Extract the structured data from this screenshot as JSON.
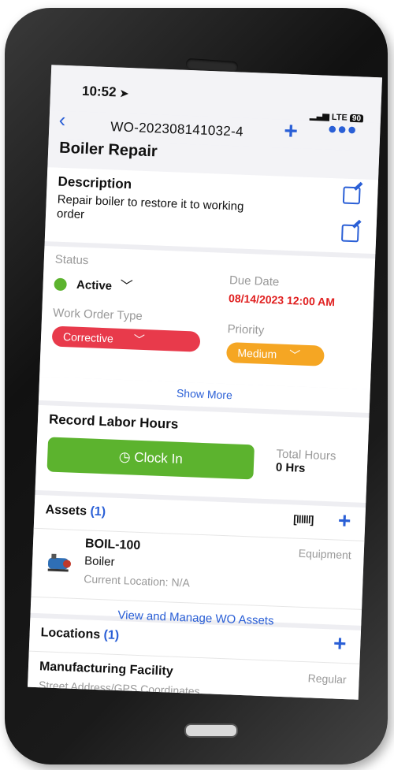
{
  "status_bar": {
    "time": "10:52",
    "network": "LTE",
    "battery": "90"
  },
  "nav": {
    "work_order_id": "WO-202308141032-4"
  },
  "page": {
    "title": "Boiler Repair"
  },
  "description": {
    "label": "Description",
    "text": "Repair boiler to restore it to working order"
  },
  "details": {
    "status_label": "Status",
    "status_value": "Active",
    "due_label": "Due Date",
    "due_value": "08/14/2023 12:00 AM",
    "type_label": "Work Order Type",
    "type_value": "Corrective",
    "priority_label": "Priority",
    "priority_value": "Medium",
    "show_more": "Show More"
  },
  "labor": {
    "title": "Record Labor Hours",
    "clock_in": "Clock In",
    "total_label": "Total Hours",
    "total_value": "0 Hrs"
  },
  "assets": {
    "title": "Assets",
    "count": "(1)",
    "item": {
      "code": "BOIL-100",
      "name": "Boiler",
      "location": "Current Location: N/A",
      "category": "Equipment"
    },
    "manage_link": "View and Manage WO Assets"
  },
  "locations": {
    "title": "Locations",
    "count": "(1)",
    "item": {
      "name": "Manufacturing Facility",
      "type": "Regular",
      "address": "Street Address/GPS Coordinates"
    }
  },
  "colors": {
    "accent": "#2a5fd6",
    "active_green": "#5cb32e",
    "corrective_red": "#e83a4b",
    "medium_orange": "#f5a623",
    "due_red": "#e02020"
  }
}
